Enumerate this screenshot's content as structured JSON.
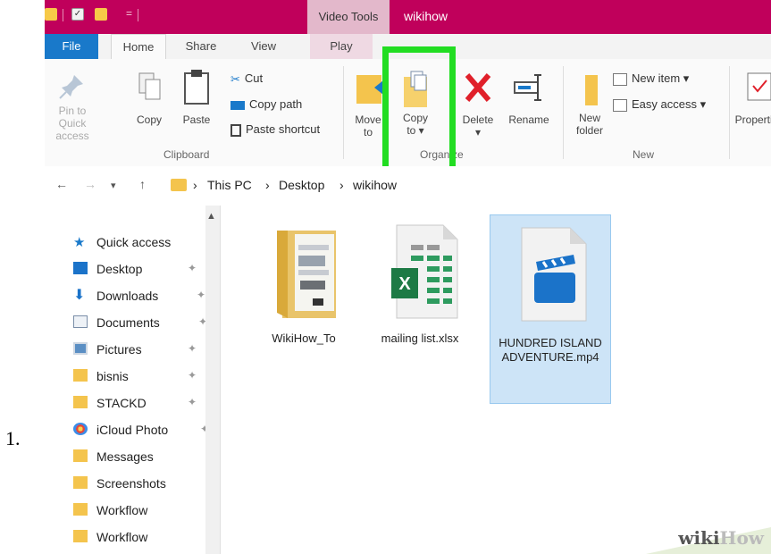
{
  "step_number": "1.",
  "titlebar": {
    "context_tab": "Video Tools",
    "window_title": "wikihow"
  },
  "tabs": {
    "file": "File",
    "home": "Home",
    "share": "Share",
    "view": "View",
    "play": "Play"
  },
  "ribbon": {
    "pin_quick_access": "Pin to Quick access",
    "copy": "Copy",
    "paste": "Paste",
    "cut": "Cut",
    "copy_path": "Copy path",
    "paste_shortcut": "Paste shortcut",
    "clipboard_group": "Clipboard",
    "move_to": "Move to",
    "copy_to_line1": "Copy",
    "copy_to_line2": "to",
    "delete": "Delete",
    "rename": "Rename",
    "organize_group": "Organize",
    "new_folder_line1": "New",
    "new_folder_line2": "folder",
    "new_item": "New item",
    "easy_access": "Easy access",
    "new_group": "New",
    "properties": "Properties"
  },
  "address": {
    "crumbs": [
      "This PC",
      "Desktop",
      "wikihow"
    ]
  },
  "sidebar": {
    "quick_access": "Quick access",
    "items": [
      {
        "label": "Desktop",
        "pinned": true
      },
      {
        "label": "Downloads",
        "pinned": true
      },
      {
        "label": "Documents",
        "pinned": true
      },
      {
        "label": "Pictures",
        "pinned": true
      },
      {
        "label": "bisnis",
        "pinned": true
      },
      {
        "label": "STACKD",
        "pinned": true
      },
      {
        "label": "iCloud Photo",
        "pinned": true
      },
      {
        "label": "Messages",
        "pinned": false
      },
      {
        "label": "Screenshots",
        "pinned": false
      },
      {
        "label": "Workflow",
        "pinned": false
      },
      {
        "label": "Workflow",
        "pinned": false
      }
    ]
  },
  "files": [
    {
      "name": "WikiHow_To",
      "type": "folder",
      "selected": false
    },
    {
      "name": "mailing list.xlsx",
      "type": "excel",
      "selected": false
    },
    {
      "name": "HUNDRED ISLAND ADVENTURE.mp4",
      "type": "video",
      "selected": true
    }
  ],
  "watermark": {
    "part1": "wiki",
    "part2": "How"
  },
  "colors": {
    "title_bar": "#c0005b",
    "file_tab": "#1979ca",
    "highlight": "#22dd22",
    "selection": "#cde4f7",
    "delete_x": "#e0202a"
  }
}
